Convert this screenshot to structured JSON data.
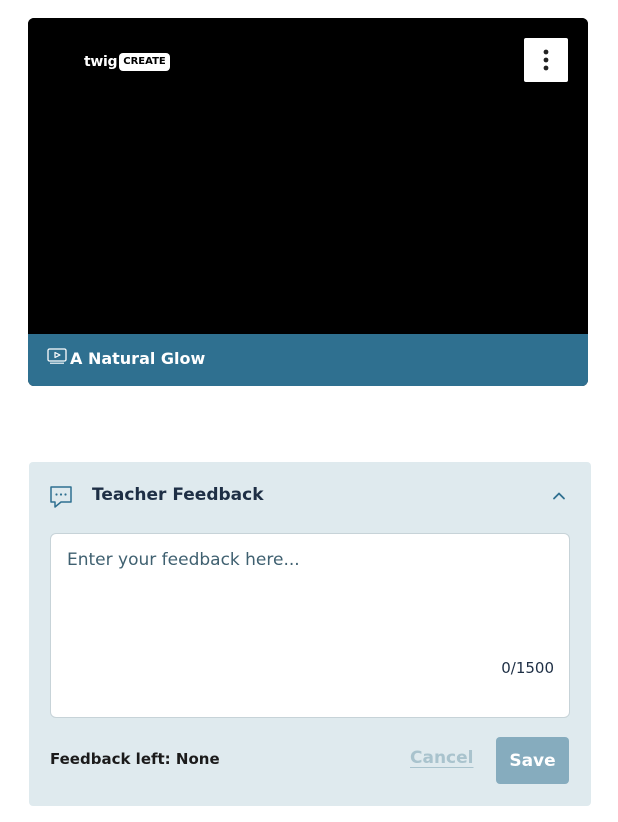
{
  "video": {
    "logo_word": "twig",
    "logo_badge": "CREATE",
    "title": "A Natural Glow",
    "menu_icon": "kebab-menu-icon",
    "play_icon": "video-play-icon"
  },
  "feedback": {
    "icon": "chat-bubble-icon",
    "title": "Teacher Feedback",
    "collapse_icon": "chevron-up-icon",
    "placeholder": "Enter your feedback here...",
    "value": "",
    "char_count": "0/1500",
    "feedback_left": "Feedback left: None",
    "cancel_label": "Cancel",
    "save_label": "Save"
  },
  "colors": {
    "title_bar": "#2f7090",
    "panel_bg": "#dfeaee",
    "save_disabled": "#86acbe",
    "cancel_disabled": "#a9c3cd"
  }
}
